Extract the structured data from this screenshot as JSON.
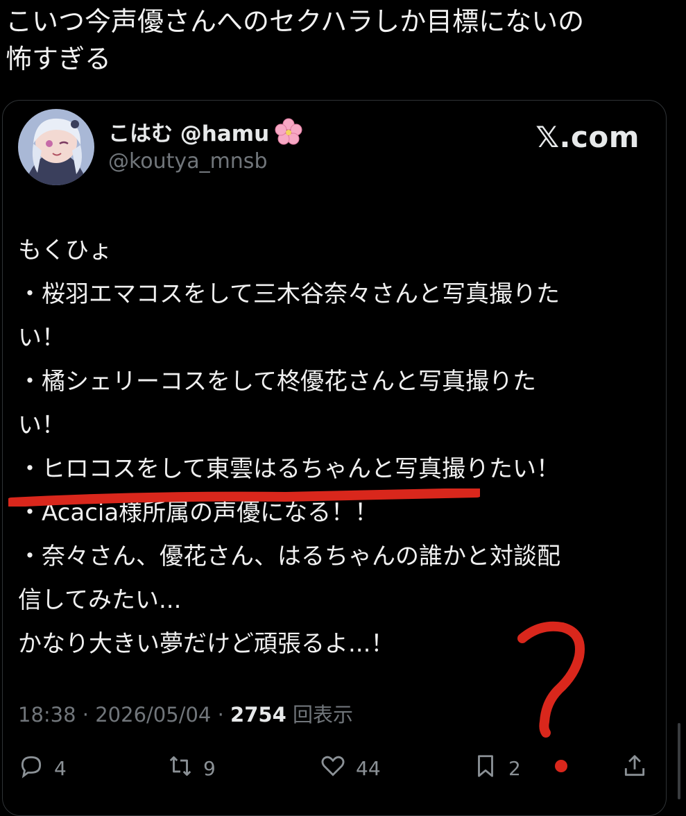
{
  "caption": {
    "line1": "こいつ今声優さんへのセクハラしか目標にないの",
    "line2": "怖すぎる"
  },
  "tweet": {
    "display_name": "こはむ @hamu",
    "handle": "@koutya_mnsb",
    "site_label": "𝕏.com",
    "body_lines": [
      "もくひょ",
      "・桜羽エマコスをして三木谷奈々さんと写真撮りた",
      "い！",
      "・橘シェリーコスをして柊優花さんと写真撮りた",
      "い！",
      "・ヒロコスをして東雲はるちゃんと写真撮りたい！",
      "・Acacia様所属の声優になる！！",
      "・奈々さん、優花さん、はるちゃんの誰かと対談配",
      "信してみたい...",
      "かなり大きい夢だけど頑張るよ...！"
    ],
    "time": "18:38",
    "date": "2026/05/04",
    "views_count": "2754",
    "views_label": "回表示",
    "replies": "4",
    "reposts": "9",
    "likes": "44",
    "bookmarks": "2"
  },
  "icons": {
    "reply": "reply-icon",
    "repost": "repost-icon",
    "like": "heart-icon",
    "bookmark": "bookmark-icon",
    "share": "share-icon",
    "flower": "cherry-blossom-icon"
  },
  "colors": {
    "annotation_red": "#d9271c",
    "muted": "#71767b"
  }
}
